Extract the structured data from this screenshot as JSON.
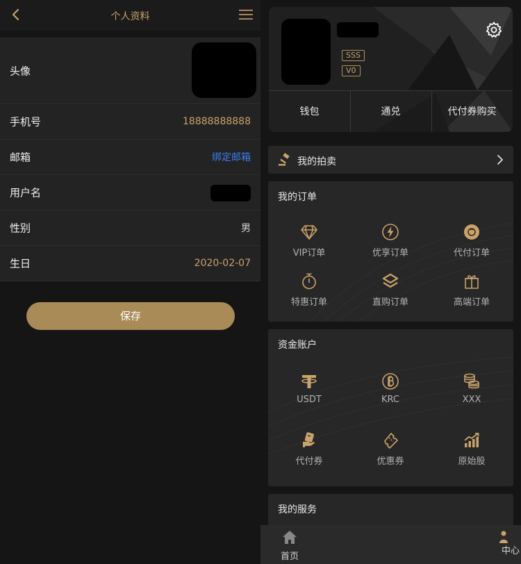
{
  "profile": {
    "header": {
      "title": "个人资料"
    },
    "rows": [
      {
        "label": "头像"
      },
      {
        "label": "手机号",
        "value": "18888888888"
      },
      {
        "label": "邮箱",
        "value": "绑定邮箱"
      },
      {
        "label": "用户名"
      },
      {
        "label": "性别",
        "value": "男"
      },
      {
        "label": "生日",
        "value": "2020-02-07"
      }
    ],
    "save_label": "保存"
  },
  "center": {
    "tags": [
      "SSS",
      "V0"
    ],
    "quick_links": [
      "钱包",
      "通兑",
      "代付券购买"
    ],
    "auction_label": "我的拍卖",
    "orders": {
      "title": "我的订单",
      "items": [
        {
          "label": "VIP订单",
          "icon": "diamond-icon"
        },
        {
          "label": "优享订单",
          "icon": "lightning-icon"
        },
        {
          "label": "代付订单",
          "icon": "coin-icon"
        },
        {
          "label": "特惠订单",
          "icon": "stopwatch-icon"
        },
        {
          "label": "直购订单",
          "icon": "layers-icon"
        },
        {
          "label": "高端订单",
          "icon": "gift-icon"
        }
      ]
    },
    "assets": {
      "title": "资金账户",
      "items": [
        {
          "label": "USDT",
          "icon": "tether-icon"
        },
        {
          "label": "KRC",
          "icon": "bitcoin-icon"
        },
        {
          "label": "XXX",
          "icon": "coins-stack-icon"
        },
        {
          "label": "代付券",
          "icon": "voucher-hand-icon"
        },
        {
          "label": "优惠券",
          "icon": "ticket-icon"
        },
        {
          "label": "原始股",
          "icon": "chart-up-icon"
        }
      ]
    },
    "services": {
      "title": "我的服务"
    },
    "tabbar": {
      "home": "首页",
      "me": "中心"
    }
  },
  "colors": {
    "gold": "#c9a36b",
    "button": "#a98b57",
    "link": "#3b7cf0",
    "card": "#272727",
    "background": "#151515"
  }
}
